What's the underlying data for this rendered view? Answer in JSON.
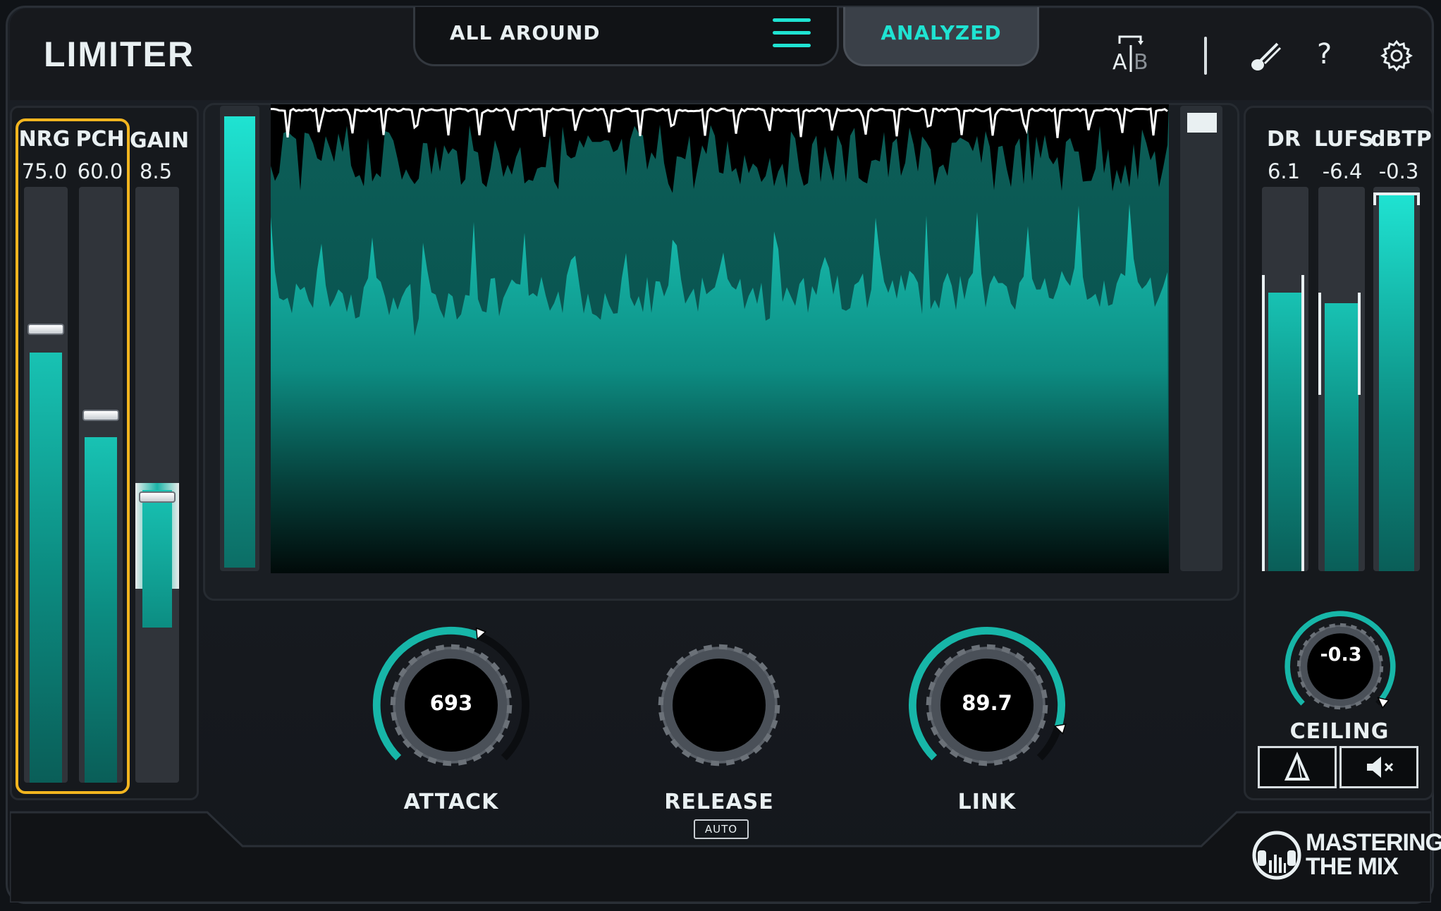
{
  "app": {
    "title": "LIMITER"
  },
  "header": {
    "preset_name": "ALL AROUND",
    "analyzed_label": "ANALYZED",
    "ab_label_a": "A",
    "ab_label_b": "B",
    "help_symbol": "?"
  },
  "left_meters": [
    {
      "label": "NRG",
      "value": "75.0",
      "level": 0.75
    },
    {
      "label": "PCH",
      "value": "60.0",
      "level": 0.6
    },
    {
      "label": "GAIN",
      "value": "8.5",
      "level": 0.45
    }
  ],
  "knobs": [
    {
      "label": "ATTACK",
      "value": "693",
      "level": 0.58
    },
    {
      "label": "RELEASE",
      "value": "",
      "sub": "AUTO",
      "level": 0
    },
    {
      "label": "LINK",
      "value": "89.7",
      "level": 0.897
    }
  ],
  "right_meters": [
    {
      "label": "DR",
      "value": "6.1",
      "level": 0.73
    },
    {
      "label": "LUFS",
      "value": "-6.4",
      "level": 0.7
    },
    {
      "label": "dBTP",
      "value": "-0.3",
      "level": 0.98
    }
  ],
  "ceiling": {
    "label": "CEILING",
    "value": "-0.3"
  },
  "logo": {
    "line1": "MASTERING",
    "line2": "THE MIX"
  },
  "colors": {
    "accent": "#1fe3d2",
    "selection": "#f2b51f",
    "panel": "#16191d"
  },
  "icons": [
    "menu-icon",
    "ab-compare-icon",
    "brush-icon",
    "help-icon",
    "gear-icon",
    "delta-icon",
    "mute-icon"
  ]
}
